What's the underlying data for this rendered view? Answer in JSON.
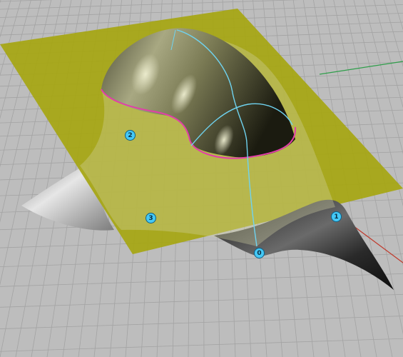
{
  "viewport": {
    "background_color": "#bdbdbd",
    "grid_line_color": "#a3a3a3",
    "plane_color": "#a6a612",
    "surface_highlight_color": "#d8d8b0",
    "surface_shadow_color": "#1c1c10",
    "trim_curve_color": "#e23ea8",
    "isocurve_color": "#6fd3f0",
    "x_axis_color": "#c0392b",
    "y_axis_color": "#2e9e4a"
  },
  "markers": [
    {
      "id": "marker-0",
      "label": "0",
      "color": "#44c8f5"
    },
    {
      "id": "marker-1",
      "label": "1",
      "color": "#44c8f5"
    },
    {
      "id": "marker-2",
      "label": "2",
      "color": "#44c8f5"
    },
    {
      "id": "marker-3",
      "label": "3",
      "color": "#44c8f5"
    }
  ]
}
